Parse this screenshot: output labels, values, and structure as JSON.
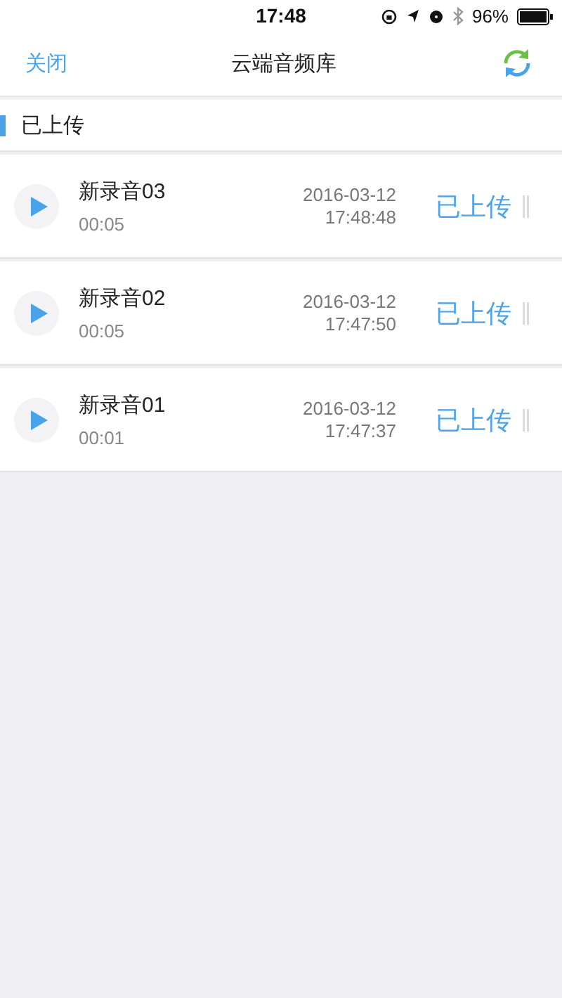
{
  "status_bar": {
    "time": "17:48",
    "battery": "96%"
  },
  "nav": {
    "left": "关闭",
    "title": "云端音频库"
  },
  "section": {
    "title": "已上传"
  },
  "recordings": [
    {
      "name": "新录音03",
      "duration": "00:05",
      "date": "2016-03-12",
      "time": "17:48:48",
      "status": "已上传"
    },
    {
      "name": "新录音02",
      "duration": "00:05",
      "date": "2016-03-12",
      "time": "17:47:50",
      "status": "已上传"
    },
    {
      "name": "新录音01",
      "duration": "00:01",
      "date": "2016-03-12",
      "time": "17:47:37",
      "status": "已上传"
    }
  ]
}
